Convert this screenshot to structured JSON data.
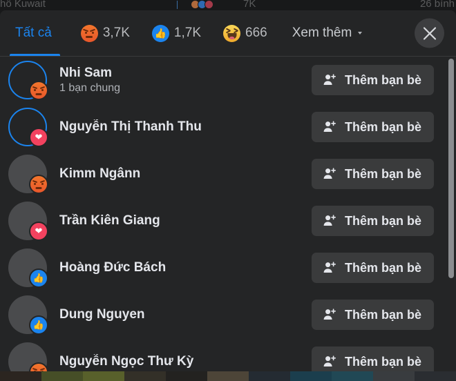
{
  "background": {
    "left_text": "hô Kuwait",
    "reaction_count": "7K",
    "right_text": "26 bình",
    "reaction_icons": [
      "hug-reaction-icon",
      "like-reaction-icon",
      "love-reaction-icon"
    ]
  },
  "header": {
    "tabs": [
      {
        "id": "all",
        "label": "Tất cả",
        "count": "",
        "icon": "",
        "active": true
      },
      {
        "id": "angry",
        "label": "",
        "count": "3,7K",
        "icon": "angry-reaction-icon",
        "active": false
      },
      {
        "id": "like",
        "label": "",
        "count": "1,7K",
        "icon": "like-reaction-icon",
        "active": false
      },
      {
        "id": "haha",
        "label": "",
        "count": "666",
        "icon": "haha-reaction-icon",
        "active": false
      }
    ],
    "more_label": "Xem thêm",
    "close_label": "Đóng",
    "accent_color": "#1b84ee"
  },
  "list": {
    "add_friend_label": "Thêm bạn bè",
    "people": [
      {
        "name": "Nhi Sam",
        "subtitle": "1 bạn chung",
        "reaction": "angry",
        "has_story_ring": true,
        "avatar": "ph-nhi"
      },
      {
        "name": "Nguyễn Thị Thanh Thu",
        "subtitle": "",
        "reaction": "love",
        "has_story_ring": true,
        "avatar": "ph-thanh"
      },
      {
        "name": "Kimm Ngânn",
        "subtitle": "",
        "reaction": "angry",
        "has_story_ring": false,
        "avatar": "ph-kimm"
      },
      {
        "name": "Trần Kiên Giang",
        "subtitle": "",
        "reaction": "love",
        "has_story_ring": false,
        "avatar": "ph-tran"
      },
      {
        "name": "Hoàng Đức Bách",
        "subtitle": "",
        "reaction": "like",
        "has_story_ring": false,
        "avatar": "ph-hoang"
      },
      {
        "name": "Dung Nguyen",
        "subtitle": "",
        "reaction": "like",
        "has_story_ring": false,
        "avatar": "ph-dung"
      },
      {
        "name": "Nguyễn Ngọc Thư Kỳ",
        "subtitle": "",
        "reaction": "angry",
        "has_story_ring": false,
        "avatar": "ph-default"
      }
    ]
  },
  "colors": {
    "sheet_bg": "#242526",
    "page_bg": "#18191a",
    "button_bg": "#3a3b3c",
    "text_primary": "#e4e6eb",
    "text_secondary": "#b0b3b8",
    "accent": "#1b84ee"
  }
}
